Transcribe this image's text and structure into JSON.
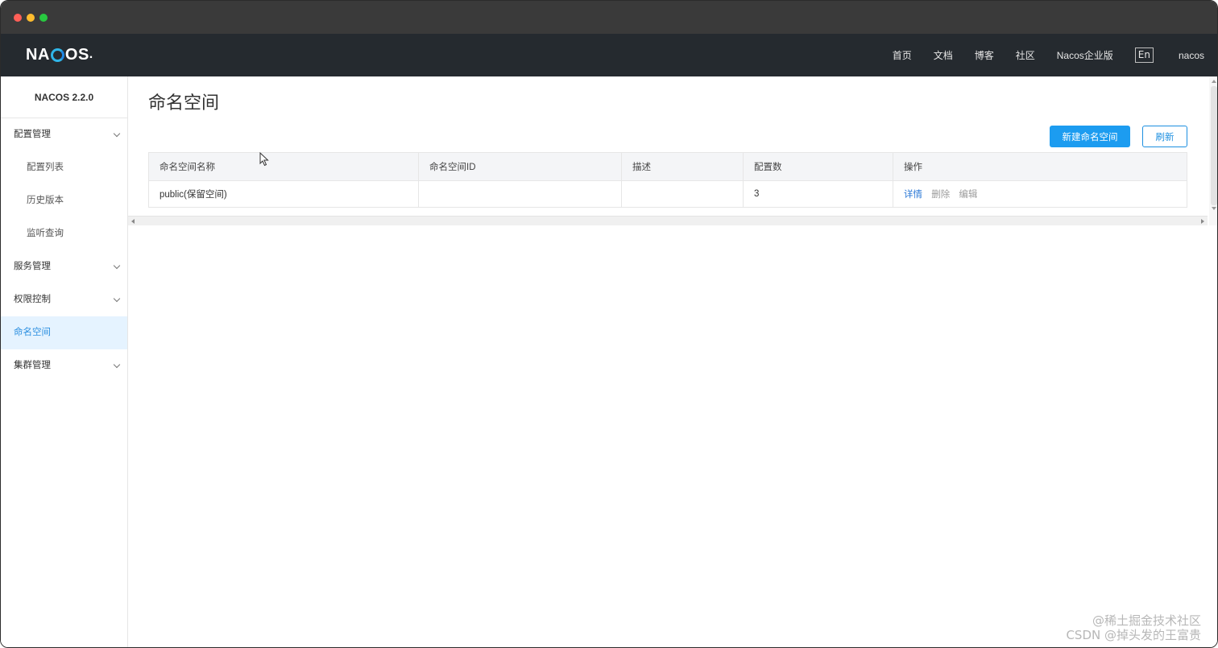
{
  "topnav": {
    "logo": "NACOS",
    "links": [
      "首页",
      "文档",
      "博客",
      "社区",
      "Nacos企业版"
    ],
    "lang": "En",
    "user": "nacos"
  },
  "sidebar": {
    "version": "NACOS 2.2.0",
    "items": [
      {
        "label": "配置管理",
        "type": "group"
      },
      {
        "label": "配置列表",
        "type": "sub"
      },
      {
        "label": "历史版本",
        "type": "sub"
      },
      {
        "label": "监听查询",
        "type": "sub"
      },
      {
        "label": "服务管理",
        "type": "group"
      },
      {
        "label": "权限控制",
        "type": "group"
      },
      {
        "label": "命名空间",
        "type": "active"
      },
      {
        "label": "集群管理",
        "type": "group"
      }
    ]
  },
  "main": {
    "title": "命名空间",
    "buttons": {
      "create": "新建命名空间",
      "refresh": "刷新"
    },
    "table": {
      "columns": [
        "命名空间名称",
        "命名空间ID",
        "描述",
        "配置数",
        "操作"
      ],
      "rows": [
        {
          "name": "public(保留空间)",
          "id": "",
          "desc": "",
          "count": "3",
          "actions": {
            "detail": "详情",
            "delete": "删除",
            "edit": "编辑"
          }
        }
      ]
    }
  },
  "watermark": {
    "line1": "@稀土掘金技术社区",
    "line2": "CSDN @掉头发的王富贵"
  },
  "colors": {
    "primary": "#1c9cf0",
    "topnav": "#252a2f",
    "active_bg": "#e5f3ff",
    "link": "#2b78d6"
  }
}
